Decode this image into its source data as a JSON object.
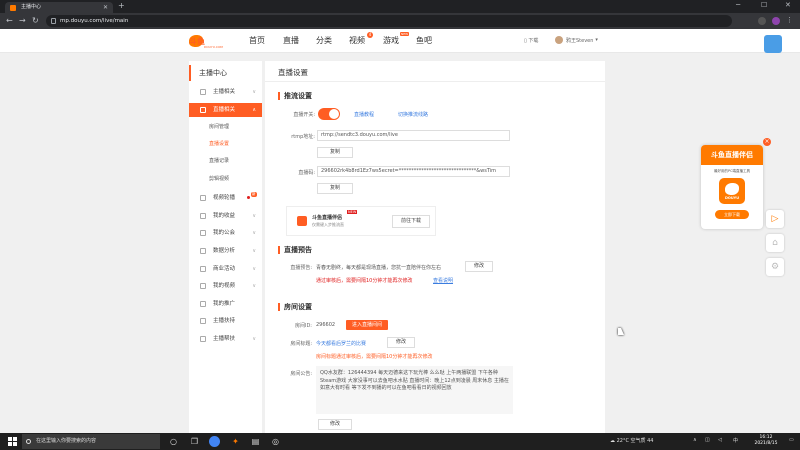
{
  "browser": {
    "tab_title": "主播中心",
    "url": "mp.douyu.com/live/main"
  },
  "header": {
    "logo_text": "斗鱼",
    "logo_sub": "DOUYU.COM",
    "nav": [
      "首页",
      "直播",
      "分类",
      "视频",
      "游戏",
      "鱼吧"
    ],
    "video_badge": "4",
    "game_tag": "NEW",
    "download": "下载",
    "username": "鸦王Steven"
  },
  "sidebar": {
    "title": "主播中心",
    "items": [
      {
        "label": "主播相关"
      },
      {
        "label": "直播相关"
      },
      {
        "label": "房间管理"
      },
      {
        "label": "直播设置"
      },
      {
        "label": "直播记录"
      },
      {
        "label": "剪辑视频"
      },
      {
        "label": "视频轮播"
      },
      {
        "label": "我的收益"
      },
      {
        "label": "我的公会"
      },
      {
        "label": "数据分析"
      },
      {
        "label": "商业活动"
      },
      {
        "label": "我的视频"
      },
      {
        "label": "我的推广"
      },
      {
        "label": "主播扶持"
      },
      {
        "label": "主播帮扶"
      }
    ],
    "carousel_tag": "新"
  },
  "main": {
    "page_title": "直播设置",
    "stream": {
      "section_title": "推流设置",
      "switch_label": "直播开关:",
      "link1": "直播教程",
      "link2": "切换推流线路",
      "rtmp_label": "rtmp地址:",
      "rtmp_value": "rtmp://sendtc3.douyu.com/live",
      "copy": "复制",
      "code_label": "直播码:",
      "code_value": "296602rk4b8rd1Ez7ws5ecret=*******************************&wsTim",
      "promo_title": "斗鱼直播伴侣",
      "promo_new": "NEW",
      "promo_desc": "仅需键入步推流直",
      "promo_btn": "前往下载"
    },
    "preview": {
      "section_title": "直播预告",
      "label": "直播预告:",
      "text": "青春无剧终，每天都是现场直播，您抗一直陪伴在你左右",
      "edit": "修改",
      "status": "通过审核后，需要间隔10分钟才能再次修改",
      "link": "查看说明"
    },
    "room": {
      "section_title": "房间设置",
      "id_label": "房间ID:",
      "id_value": "296602",
      "enter_btn": "进入直播间间",
      "title_label": "房间标题:",
      "title_value": "今天都看后罗兰的比赛",
      "edit": "修改",
      "title_status": "房间标题通过审核后，需要间隔10分钟才能再次修改",
      "notice_label": "房间公告:",
      "notice_text": "QQ水友群：126444394 每天迈德来这下玩光棒 么么哒 上午两播联盟 下午各种Steam游戏 大家没事可以去鱼吧水水贴 直播时间：晚上12点到凌晨 周末休息 主播在如意大有时看 等下发不到播的可以在鱼吧看看日的视频回放",
      "notice_edit": "修改"
    }
  },
  "float_widget": {
    "title": "斗鱼直播伴侣",
    "desc": "最好用的PC端直播工具",
    "app_name": "DOUYU",
    "download": "立即下载"
  },
  "taskbar": {
    "search_placeholder": "在这里输入你要搜索的内容",
    "weather": "22°C 空气质 44",
    "ime": "中",
    "time": "16:12",
    "date": "2021/8/15"
  }
}
